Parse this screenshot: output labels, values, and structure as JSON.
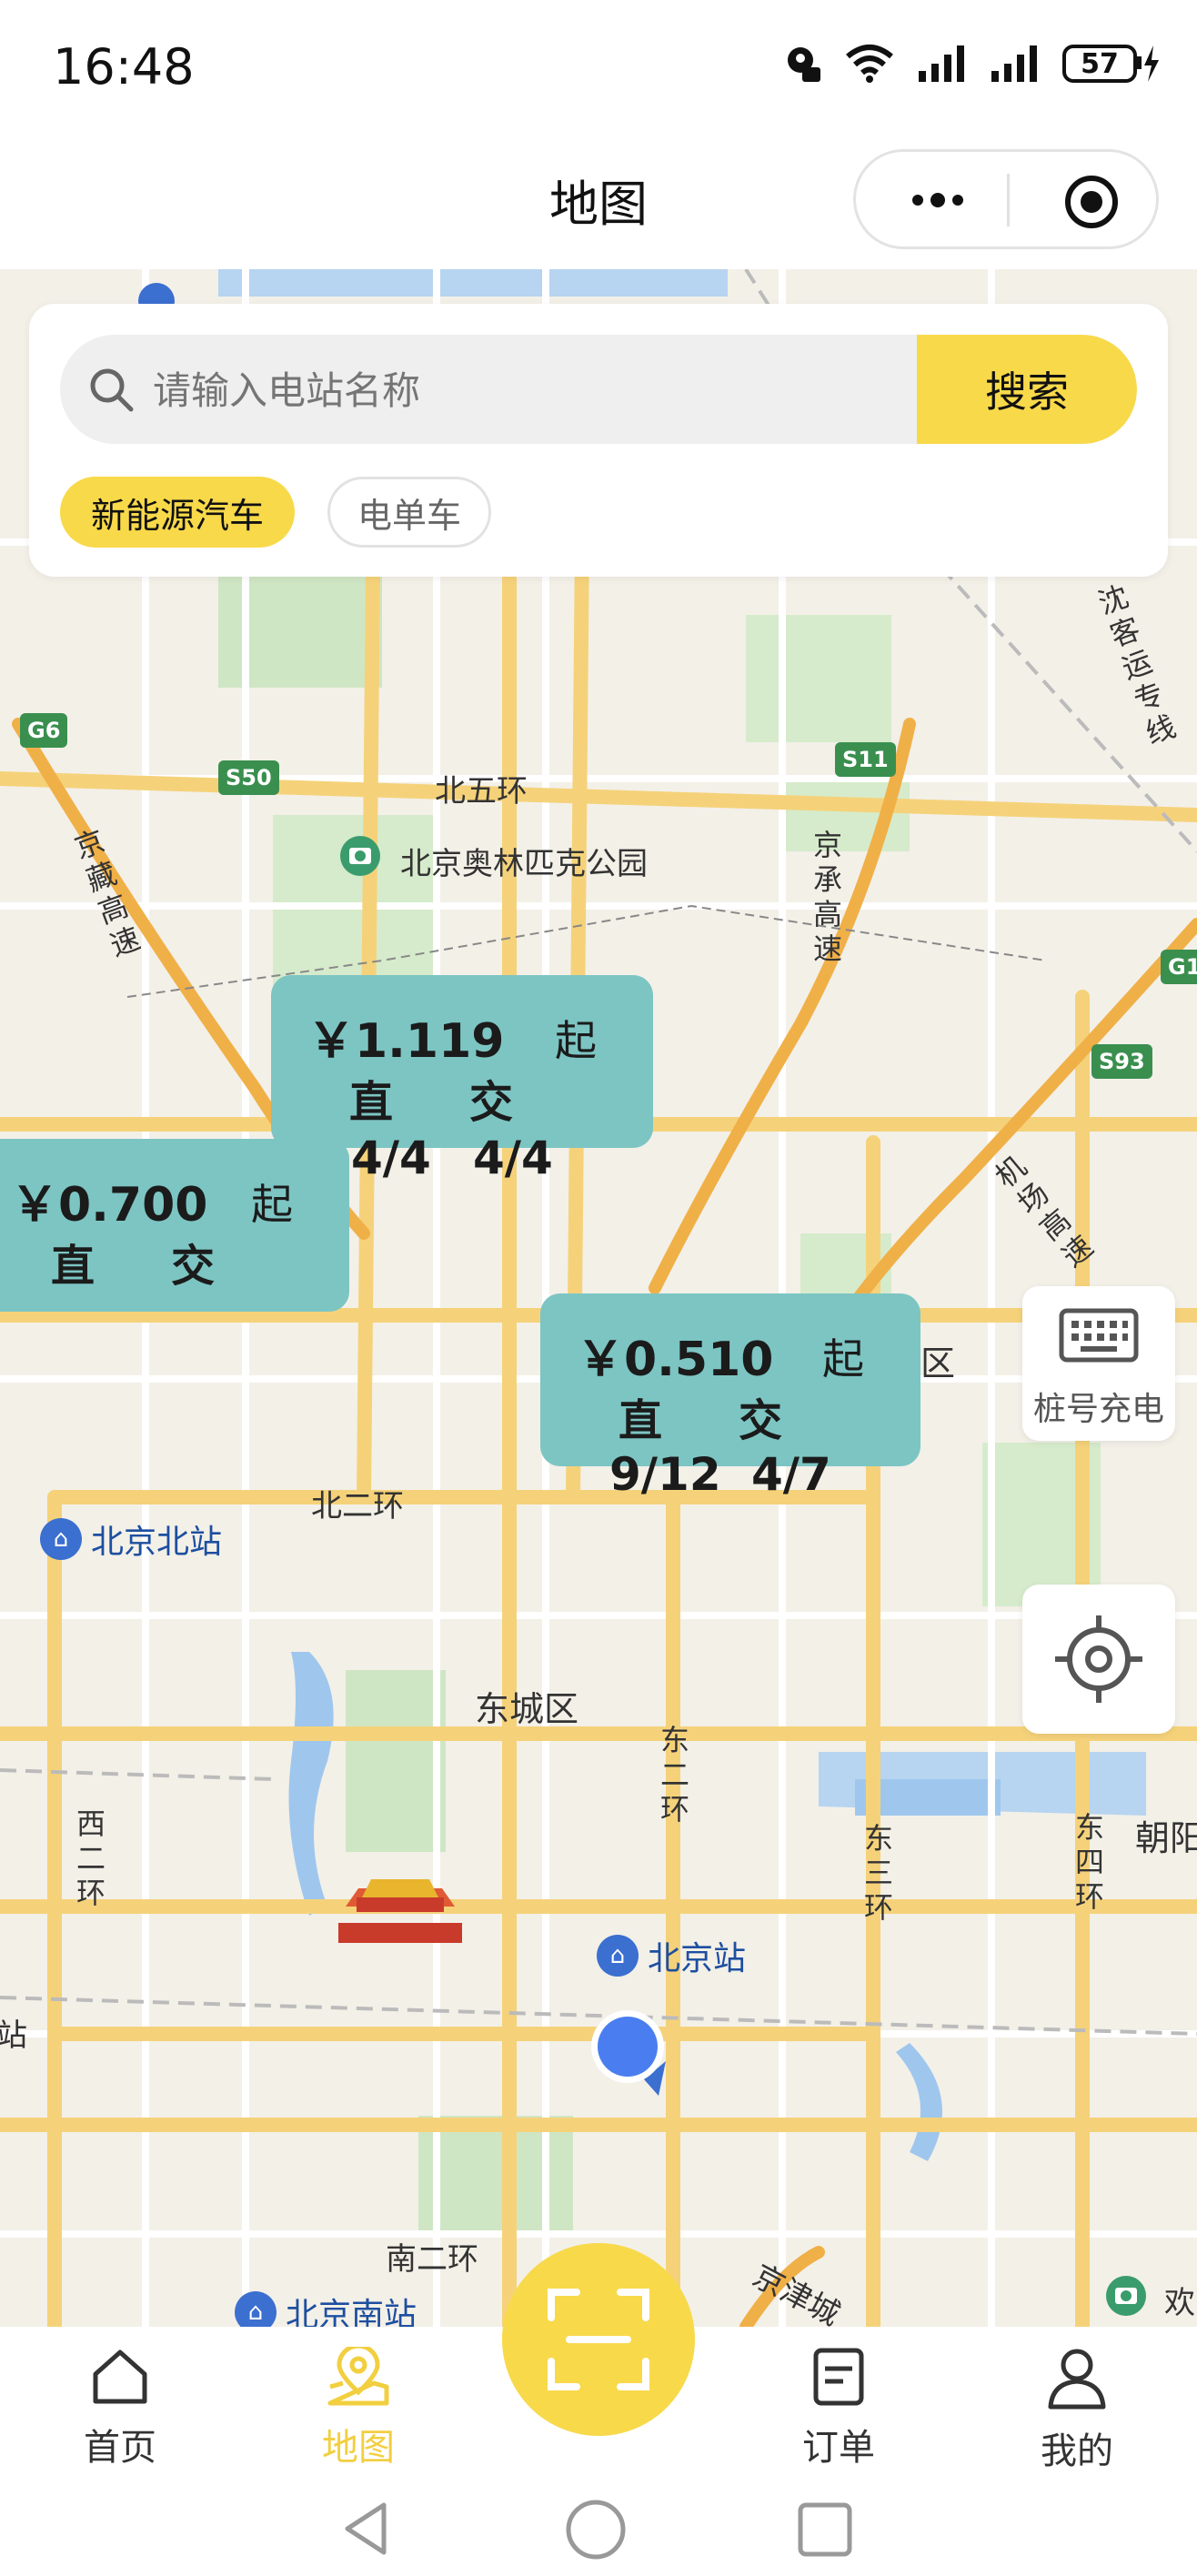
{
  "status_bar": {
    "time": "16:48",
    "battery": "57"
  },
  "header": {
    "title": "地图"
  },
  "search": {
    "placeholder": "请输入电站名称",
    "button_label": "搜索"
  },
  "filters": [
    {
      "label": "新能源汽车",
      "active": true
    },
    {
      "label": "电单车",
      "active": false
    }
  ],
  "map": {
    "labels": {
      "north5": "北五环",
      "olympic_park": "北京奥林匹克公园",
      "north2": "北二环",
      "dongcheng": "东城区",
      "district_right": "区",
      "chaoyang": "朝阳",
      "south2": "南二环",
      "huan": "欢",
      "jingzang": "京藏高速",
      "jingcheng": "京承高速",
      "shenke": "沈客运专线",
      "airport": "机场高速",
      "east2": "东二环",
      "west2": "西二环",
      "east3": "东三环",
      "east4": "东四环",
      "jingjin": "京津城",
      "edge_zhan": "站"
    },
    "shields": {
      "g6": "G6",
      "s50": "S50",
      "s11": "S11",
      "s93": "S93",
      "g1": "G1"
    },
    "stations": {
      "beijing_north": "北京北站",
      "beijing": "北京站",
      "beijing_south": "北京南站"
    }
  },
  "markers": [
    {
      "price": "￥1.119",
      "suffix": "起",
      "dc_label": "直",
      "ac_label": "交",
      "dc_count": "4/4",
      "ac_count": "4/4"
    },
    {
      "price": "￥0.700",
      "suffix": "起",
      "dc_label": "直",
      "ac_label": "交",
      "dc_count": "",
      "ac_count": ""
    },
    {
      "price": "￥0.510",
      "suffix": "起",
      "dc_label": "直",
      "ac_label": "交",
      "dc_count": "9/12",
      "ac_count": "4/7"
    }
  ],
  "floating": {
    "pile_charge_label": "桩号充电"
  },
  "bottom_nav": [
    {
      "label": "首页",
      "icon": "home-icon",
      "active": false
    },
    {
      "label": "地图",
      "icon": "map-pin-icon",
      "active": true
    },
    {
      "label": "订单",
      "icon": "order-icon",
      "active": false
    },
    {
      "label": "我的",
      "icon": "user-icon",
      "active": false
    }
  ],
  "colors": {
    "accent": "#f8d94a",
    "marker": "#7cc5c3",
    "station_blue": "#3b6fd0"
  }
}
